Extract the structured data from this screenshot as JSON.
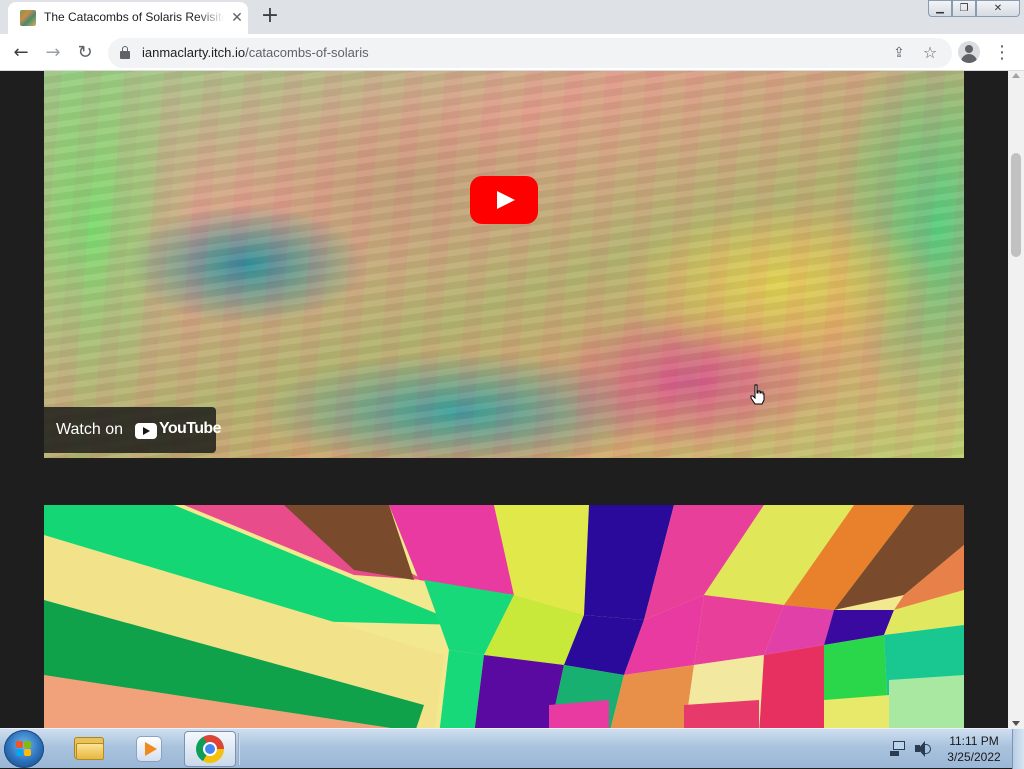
{
  "browser": {
    "tab_title": "The Catacombs of Solaris Revisited",
    "tab_close": "✕",
    "new_tab": "+",
    "url_domain": "ianmaclarty.itch.io",
    "url_path": "/catacombs-of-solaris",
    "window_controls": {
      "minimize": "▁",
      "maximize": "❐",
      "close": "✕"
    },
    "icons": {
      "back": "←",
      "forward": "→",
      "reload": "↻",
      "share": "⇪",
      "star": "☆",
      "menu": "⋮"
    }
  },
  "video": {
    "watch_on_label": "Watch on",
    "youtube_wordmark": "YouTube"
  },
  "taskbar": {
    "time": "11:11 PM",
    "date": "3/25/2022"
  },
  "colors": {
    "youtube_red": "#ff0000",
    "page_background": "#1e1e1e"
  }
}
